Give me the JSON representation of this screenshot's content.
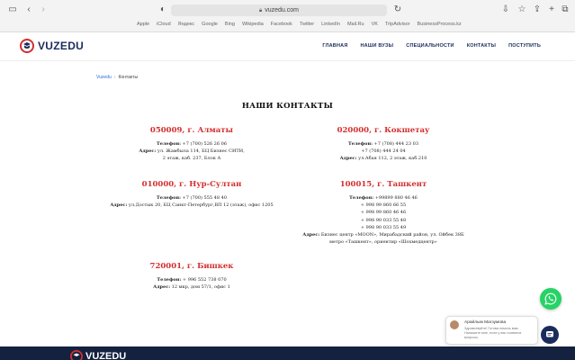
{
  "browser": {
    "url": "vuzedu.com",
    "favorites": [
      "Apple",
      "iCloud",
      "Яндекс",
      "Google",
      "Bing",
      "Wikipedia",
      "Facebook",
      "Twitter",
      "LinkedIn",
      "Mail.Ru",
      "VK",
      "TripAdvisor",
      "BusinessProcess.kz"
    ]
  },
  "site": {
    "logo_text": "VUZEDU",
    "nav": [
      "ГЛАВНАЯ",
      "НАШИ ВУЗЫ",
      "СПЕЦИАЛЬНОСТИ",
      "КОНТАКТЫ",
      "ПОСТУПИТЬ"
    ]
  },
  "breadcrumb": {
    "home": "Vuzedu",
    "separator": "›",
    "current": "Контакты"
  },
  "page_title": "НАШИ КОНТАКТЫ",
  "contacts": {
    "almaty": {
      "name": "050009, г. Алматы",
      "lines": [
        {
          "label": "Телефон:",
          "text": " +7 (700) 526 26 06"
        },
        {
          "label": "Адрес:",
          "text": " ул. Жамбыла 114, БЦ Бизнес СИТИ,"
        },
        {
          "label": "",
          "text": "2 этаж, каб. 237, Блок А"
        }
      ]
    },
    "kokshetau": {
      "name": "020000, г. Кокшетау",
      "lines": [
        {
          "label": "Телефон:",
          "text": " +7 (708) 444 23 03"
        },
        {
          "label": "",
          "text": "+7 (708) 444 24 04"
        },
        {
          "label": "Адрес:",
          "text": " ул.Абая 112, 2 этаж, каб.210"
        }
      ]
    },
    "astana": {
      "name": "010000, г. Нур-Султан",
      "lines": [
        {
          "label": "Телефон:",
          "text": " +7 (700) 555 48 40"
        },
        {
          "label": "Адрес:",
          "text": " ул.Достык 20, БЦ Санкт-Петербург,ВП 12 (этаж), офис 1205"
        }
      ]
    },
    "tashkent": {
      "name": "100015, г. Ташкент",
      "lines": [
        {
          "label": "Телефон:",
          "text": " +99899 880 46 46"
        },
        {
          "label": "",
          "text": "+ 998 99 860 66 55"
        },
        {
          "label": "",
          "text": "+ 998 99 860 46 46"
        },
        {
          "label": "",
          "text": "+ 998 90 033 55 48"
        },
        {
          "label": "",
          "text": "+ 998 90 033 55 49"
        },
        {
          "label": "Адрес:",
          "text": " Бизнес центр «MOON», Мирабадский район, ул. Ойбек 38Б"
        },
        {
          "label": "",
          "text": "метро «Ташкент», ориентир «Шохмедцентр»"
        }
      ]
    },
    "bishkek": {
      "name": "720001, г. Бишкек",
      "lines": [
        {
          "label": "Телефон:",
          "text": " + 996 552 738 070"
        },
        {
          "label": "Адрес:",
          "text": " 12 мкр, дом 57/1, офис 1"
        }
      ]
    }
  },
  "chat": {
    "agent_name": "Арайлым Магзумова",
    "message": "Здравствуйте! Готова помочь вам. Напишите мне, если у вас появятся вопросы."
  },
  "colors": {
    "brand_navy": "#1a2b5c",
    "accent_red": "#d32f2f",
    "whatsapp_green": "#25d366",
    "link_blue": "#2a6ed8"
  }
}
